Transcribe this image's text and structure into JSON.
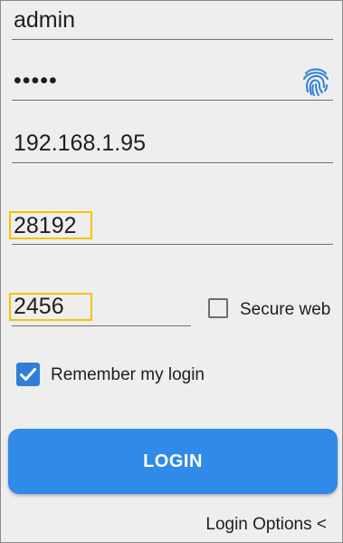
{
  "form": {
    "username": "admin",
    "password_masked": "•••••",
    "host": "192.168.1.95",
    "port": "28192",
    "web_port": "2456",
    "secure_web_label": "Secure web",
    "secure_web_checked": false,
    "remember_label": "Remember my login",
    "remember_checked": true
  },
  "buttons": {
    "login_label": "LOGIN",
    "login_options_label": "Login Options <"
  },
  "icons": {
    "fingerprint": "fingerprint-icon",
    "checkmark": "checkmark-icon"
  },
  "colors": {
    "accent": "#2f8ae8",
    "highlight": "#f2c500",
    "fingerprint": "#2d7fd6"
  }
}
